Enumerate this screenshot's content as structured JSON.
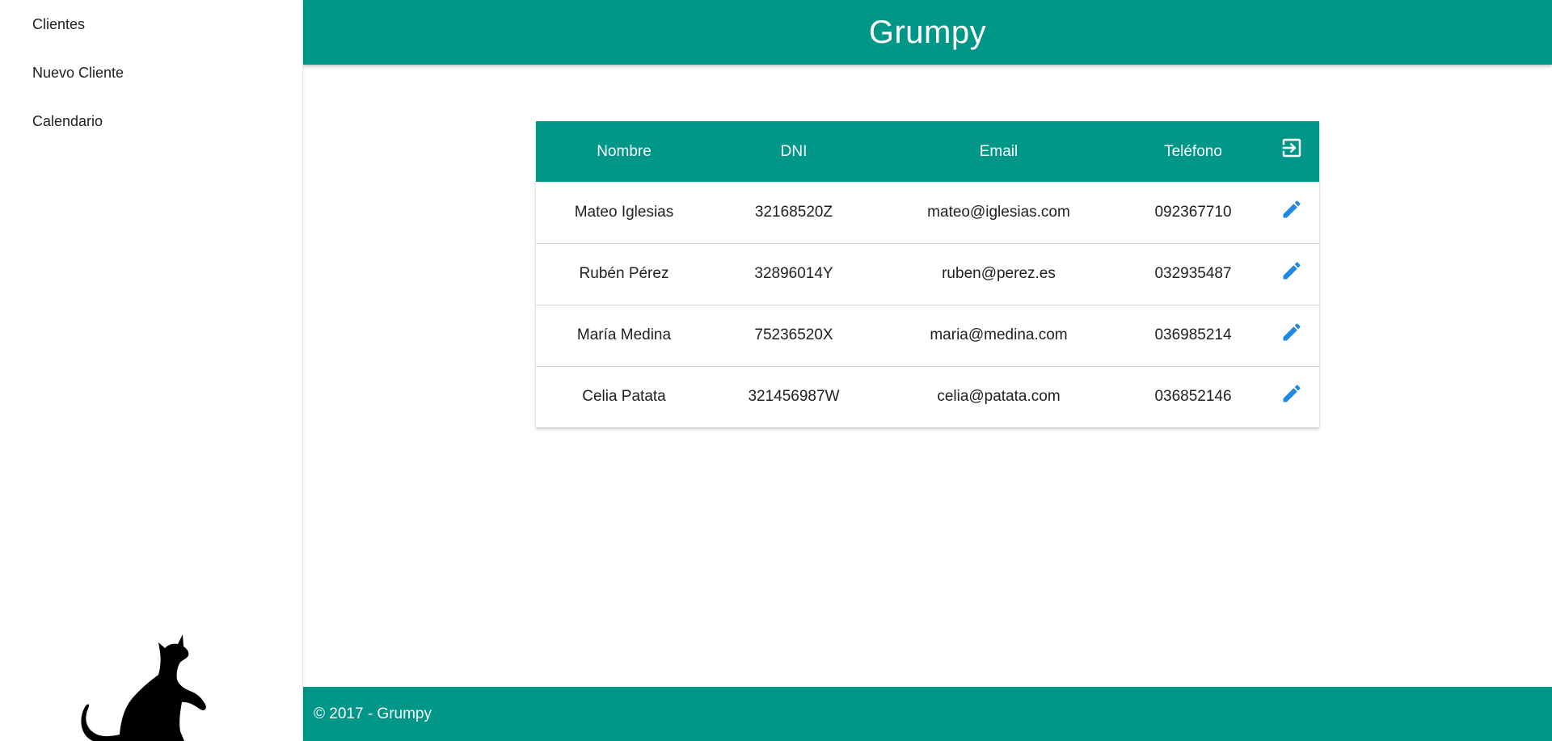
{
  "sidebar": {
    "items": [
      {
        "label": "Clientes"
      },
      {
        "label": "Nuevo Cliente"
      },
      {
        "label": "Calendario"
      }
    ]
  },
  "header": {
    "title": "Grumpy"
  },
  "table": {
    "headers": [
      "Nombre",
      "DNI",
      "Email",
      "Teléfono"
    ],
    "rows": [
      [
        "Mateo Iglesias",
        "32168520Z",
        "mateo@iglesias.com",
        "092367710"
      ],
      [
        "Rubén Pérez",
        "32896014Y",
        "ruben@perez.es",
        "032935487"
      ],
      [
        "María Medina",
        "75236520X",
        "maria@medina.com",
        "036985214"
      ],
      [
        "Celia Patata",
        "321456987W",
        "celia@patata.com",
        "036852146"
      ]
    ]
  },
  "footer": {
    "text": "© 2017 - Grumpy"
  },
  "colors": {
    "primary": "#009688",
    "edit_icon": "#1E88E5",
    "header_text": "#ffffff"
  },
  "icons": {
    "header_action": "logout-icon",
    "row_action": "edit-pencil-icon",
    "sidebar_image": "cat-silhouette"
  }
}
